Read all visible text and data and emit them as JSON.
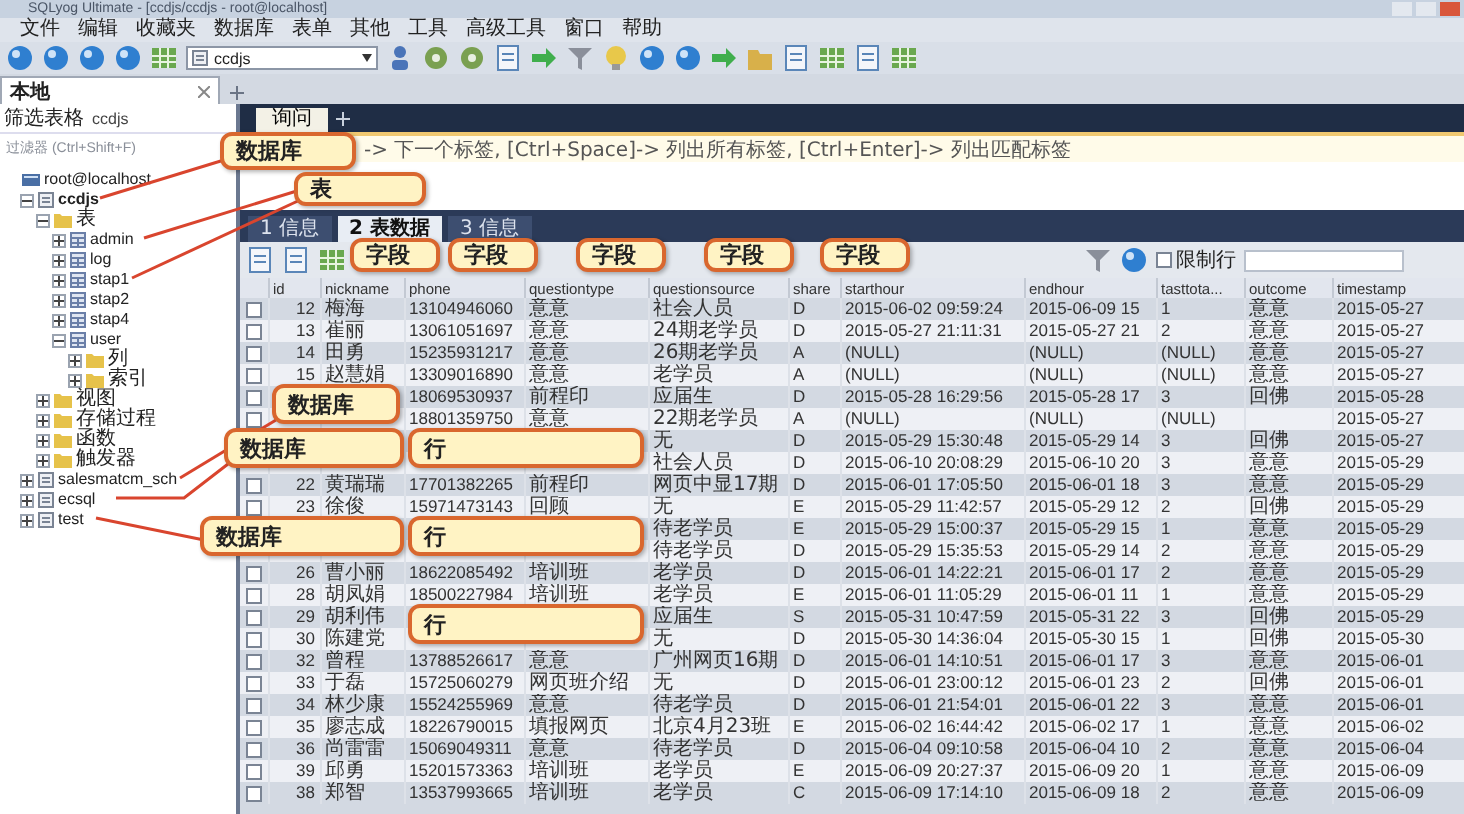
{
  "window": {
    "title": "SQLyog Ultimate - [ccdjs/ccdjs - root@localhost]"
  },
  "menu": [
    "文件",
    "编辑",
    "收藏夹",
    "数据库",
    "表单",
    "其他",
    "工具",
    "高级工具",
    "窗口",
    "帮助"
  ],
  "toolbar": {
    "database_select": "ccdjs"
  },
  "connection_tabs": [
    {
      "label": "本地",
      "selected": true
    }
  ],
  "sidebar": {
    "filter_label": "筛选表格",
    "filter_value": "ccdjs",
    "search_placeholder": "过滤器 (Ctrl+Shift+F)",
    "tree": [
      {
        "label": "root@localhost",
        "kind": "server",
        "children": [
          {
            "label": "ccdjs",
            "kind": "database",
            "expanded": true,
            "children": [
              {
                "label": "表",
                "kind": "folder",
                "expanded": true,
                "children": [
                  {
                    "label": "admin",
                    "kind": "table",
                    "expanded": false
                  },
                  {
                    "label": "log",
                    "kind": "table",
                    "expanded": false
                  },
                  {
                    "label": "stap1",
                    "kind": "table",
                    "expanded": false
                  },
                  {
                    "label": "stap2",
                    "kind": "table",
                    "expanded": false
                  },
                  {
                    "label": "stap4",
                    "kind": "table",
                    "expanded": false
                  },
                  {
                    "label": "user",
                    "kind": "table",
                    "expanded": true,
                    "children": [
                      {
                        "label": "列",
                        "kind": "folder",
                        "expanded": false
                      },
                      {
                        "label": "索引",
                        "kind": "folder",
                        "expanded": false
                      }
                    ]
                  }
                ]
              },
              {
                "label": "视图",
                "kind": "folder",
                "expanded": false
              },
              {
                "label": "存储过程",
                "kind": "folder",
                "expanded": false
              },
              {
                "label": "函数",
                "kind": "folder",
                "expanded": false
              },
              {
                "label": "触发器",
                "kind": "folder",
                "expanded": false
              }
            ]
          },
          {
            "label": "salesmatcm_sch",
            "kind": "database",
            "expanded": false
          },
          {
            "label": "ecsql",
            "kind": "database",
            "expanded": false
          },
          {
            "label": "test",
            "kind": "database",
            "expanded": false
          }
        ]
      }
    ]
  },
  "query": {
    "tabs": [
      {
        "label": "询问",
        "selected": true
      }
    ],
    "hint": "-> 下一个标签, [Ctrl+Space]-> 列出所有标签, [Ctrl+Enter]-> 列出匹配标签"
  },
  "result_tabs": [
    {
      "label": "1 信息",
      "selected": false
    },
    {
      "label": "2 表数据",
      "selected": true
    },
    {
      "label": "3 信息",
      "selected": false
    }
  ],
  "result_toolbar": {
    "limit_label": "限制行",
    "limit_checked": false
  },
  "table": {
    "columns": [
      "id",
      "nickname",
      "phone",
      "questiontype",
      "questionsource",
      "share",
      "starthour",
      "endhour",
      "tasttota...",
      "outcome",
      "timestamp"
    ],
    "rows": [
      {
        "checked": false,
        "cells": [
          "12",
          "梅海",
          "13104946060",
          "意意",
          "社会人员",
          "D",
          "2015-06-02 09:59:24",
          "2015-06-09 15",
          "1",
          "意意",
          "2015-05-27"
        ]
      },
      {
        "checked": false,
        "cells": [
          "13",
          "崔丽",
          "13061051697",
          "意意",
          "24期老学员",
          "D",
          "2015-05-27 21:11:31",
          "2015-05-27 21",
          "2",
          "意意",
          "2015-05-27"
        ]
      },
      {
        "checked": false,
        "cells": [
          "14",
          "田勇",
          "15235931217",
          "意意",
          "26期老学员",
          "A",
          "(NULL)",
          "(NULL)",
          "(NULL)",
          "意意",
          "2015-05-27"
        ]
      },
      {
        "checked": false,
        "cells": [
          "15",
          "赵慧娟",
          "13309016890",
          "意意",
          "老学员",
          "A",
          "(NULL)",
          "(NULL)",
          "(NULL)",
          "意意",
          "2015-05-27"
        ]
      },
      {
        "checked": false,
        "cells": [
          null,
          null,
          "18069530937",
          "前程印",
          "应届生",
          "D",
          "2015-05-28 16:29:56",
          "2015-05-28 17",
          "3",
          "回佛",
          "2015-05-28"
        ]
      },
      {
        "checked": false,
        "cells": [
          null,
          null,
          "18801359750",
          "意意",
          "22期老学员",
          "A",
          "(NULL)",
          "(NULL)",
          "(NULL)",
          null,
          "2015-05-27"
        ]
      },
      {
        "cells": [
          null,
          null,
          null,
          null,
          "无",
          "D",
          "2015-05-29 15:30:48",
          "2015-05-29 14",
          "3",
          "回佛",
          "2015-05-27"
        ]
      },
      {
        "cells": [
          null,
          null,
          null,
          null,
          "社会人员",
          "D",
          "2015-06-10 20:08:29",
          "2015-06-10 20",
          "3",
          "意意",
          "2015-05-29"
        ]
      },
      {
        "checked": false,
        "cells": [
          "22",
          "黄瑞瑞",
          "17701382265",
          "前程印",
          "网页中显17期",
          "D",
          "2015-06-01 17:05:50",
          "2015-06-01 18",
          "3",
          "意意",
          "2015-05-29"
        ]
      },
      {
        "checked": false,
        "cells": [
          "23",
          "徐俊",
          "15971473143",
          "回顾",
          "无",
          "E",
          "2015-05-29 11:42:57",
          "2015-05-29 12",
          "2",
          "回佛",
          "2015-05-29"
        ]
      },
      {
        "cells": [
          null,
          null,
          null,
          null,
          "待老学员",
          "E",
          "2015-05-29 15:00:37",
          "2015-05-29 15",
          "1",
          "意意",
          "2015-05-29"
        ]
      },
      {
        "cells": [
          null,
          null,
          null,
          null,
          "待老学员",
          "D",
          "2015-05-29 15:35:53",
          "2015-05-29 14",
          "2",
          "意意",
          "2015-05-29"
        ]
      },
      {
        "checked": false,
        "cells": [
          "26",
          "曹小丽",
          "18622085492",
          "培训班",
          "老学员",
          "D",
          "2015-06-01 14:22:21",
          "2015-06-01 17",
          "2",
          "意意",
          "2015-05-29"
        ]
      },
      {
        "checked": false,
        "cells": [
          "28",
          "胡凤娟",
          "18500227984",
          "培训班",
          "老学员",
          "E",
          "2015-06-01 11:05:29",
          "2015-06-01 11",
          "1",
          "意意",
          "2015-05-29"
        ]
      },
      {
        "checked": false,
        "cells": [
          "29",
          "胡利伟",
          null,
          null,
          "应届生",
          "S",
          "2015-05-31 10:47:59",
          "2015-05-31 22",
          "3",
          "回佛",
          "2015-05-29"
        ]
      },
      {
        "checked": false,
        "cells": [
          "30",
          "陈建党",
          null,
          null,
          "无",
          "D",
          "2015-05-30 14:36:04",
          "2015-05-30 15",
          "1",
          "回佛",
          "2015-05-30"
        ]
      },
      {
        "checked": false,
        "cells": [
          "32",
          "曾程",
          "13788526617",
          "意意",
          "广州网页16期",
          "D",
          "2015-06-01 14:10:51",
          "2015-06-01 17",
          "3",
          "意意",
          "2015-06-01"
        ]
      },
      {
        "checked": false,
        "cells": [
          "33",
          "于磊",
          "15725060279",
          "网页班介绍",
          "无",
          "D",
          "2015-06-01 23:00:12",
          "2015-06-01 23",
          "2",
          "回佛",
          "2015-06-01"
        ]
      },
      {
        "checked": false,
        "cells": [
          "34",
          "林少康",
          "15524255969",
          "意意",
          "待老学员",
          "D",
          "2015-06-01 21:54:01",
          "2015-06-01 22",
          "3",
          "意意",
          "2015-06-01"
        ]
      },
      {
        "checked": false,
        "cells": [
          "35",
          "廖志成",
          "18226790015",
          "填报网页",
          "北京4月23班",
          "E",
          "2015-06-02 16:44:42",
          "2015-06-02 17",
          "1",
          "意意",
          "2015-06-02"
        ]
      },
      {
        "checked": false,
        "cells": [
          "36",
          "尚雷雷",
          "15069049311",
          "意意",
          "待老学员",
          "D",
          "2015-06-04 09:10:58",
          "2015-06-04 10",
          "2",
          "意意",
          "2015-06-04"
        ]
      },
      {
        "checked": false,
        "cells": [
          "39",
          "邱勇",
          "15201573363",
          "培训班",
          "老学员",
          "E",
          "2015-06-09 20:27:37",
          "2015-06-09 20",
          "1",
          "意意",
          "2015-06-09"
        ]
      },
      {
        "checked": false,
        "cells": [
          "38",
          "郑智",
          "13537993665",
          "培训班",
          "老学员",
          "C",
          "2015-06-09 17:14:10",
          "2015-06-09 18",
          "2",
          "意意",
          "2015-06-09"
        ]
      }
    ]
  },
  "callouts": [
    {
      "text": "数据库"
    },
    {
      "text": "表"
    },
    {
      "text": "字段"
    },
    {
      "text": "字段"
    },
    {
      "text": "字段"
    },
    {
      "text": "字段"
    },
    {
      "text": "字段"
    },
    {
      "text": "数据库"
    },
    {
      "text": "数据库"
    },
    {
      "text": "数据库"
    },
    {
      "text": "行"
    },
    {
      "text": "行"
    },
    {
      "text": "行"
    }
  ]
}
